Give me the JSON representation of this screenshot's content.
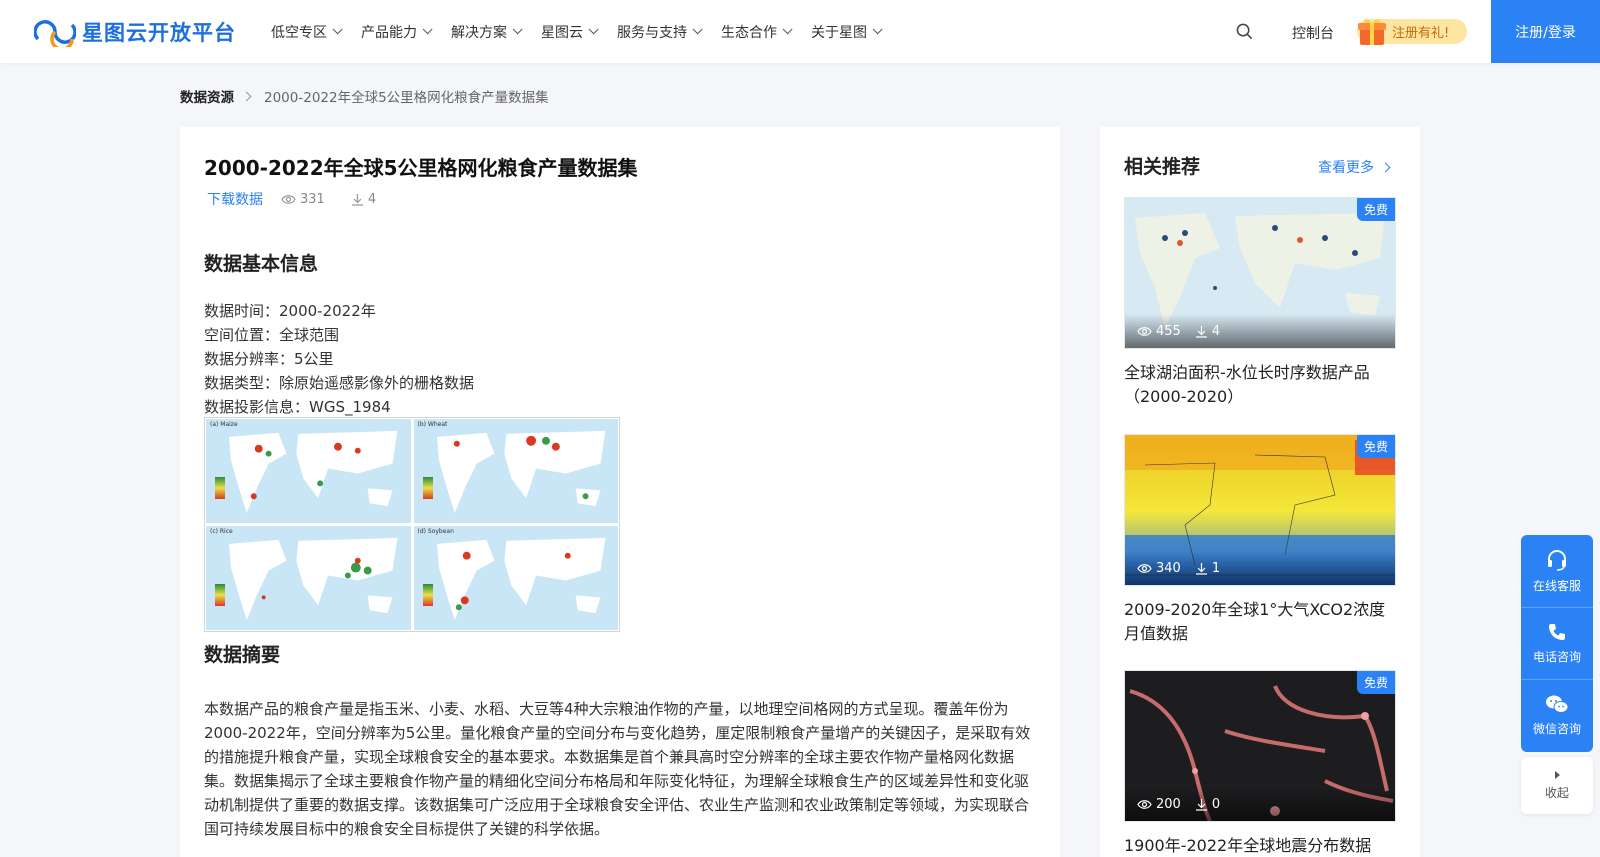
{
  "brand": {
    "name": "星图云开放平台",
    "accent": "#2a82f5"
  },
  "nav": {
    "items": [
      "低空专区",
      "产品能力",
      "解决方案",
      "星图云",
      "服务与支持",
      "生态合作",
      "关于星图"
    ],
    "console": "控制台",
    "gift": "注册有礼!",
    "login": "注册/登录"
  },
  "breadcrumb": {
    "root": "数据资源",
    "current": "2000-2022年全球5公里格网化粮食产量数据集"
  },
  "dataset": {
    "title": "2000-2022年全球5公里格网化粮食产量数据集",
    "download_label": "下载数据",
    "views": "331",
    "downloads": "4",
    "basic_heading": "数据基本信息",
    "info": [
      "数据时间：2000-2022年",
      "空间位置：全球范围",
      "数据分辨率：5公里",
      "数据类型：除原始遥感影像外的栅格数据",
      "数据投影信息：WGS_1984"
    ],
    "figure_panels": [
      "(a) Maize",
      "(b) Wheat",
      "(c) Rice",
      "(d) Soybean"
    ],
    "abstract_heading": "数据摘要",
    "abstract": "本数据产品的粮食产量是指玉米、小麦、水稻、大豆等4种大宗粮油作物的产量，以地理空间格网的方式呈现。覆盖年份为2000-2022年，空间分辨率为5公里。量化粮食产量的空间分布与变化趋势，厘定限制粮食产量增产的关键因子，是采取有效的措施提升粮食产量，实现全球粮食安全的基本要求。本数据集是首个兼具高时空分辨率的全球主要农作物产量格网化数据集。数据集揭示了全球主要粮食作物产量的精细化空间分布格局和年际变化特征，为理解全球粮食生产的区域差异性和变化驱动机制提供了重要的数据支撑。该数据集可广泛应用于全球粮食安全评估、农业生产监测和农业政策制定等领域，为实现联合国可持续发展目标中的粮食安全目标提供了关键的科学依据。"
  },
  "sidebar": {
    "heading": "相关推荐",
    "more": "查看更多",
    "cards": [
      {
        "badge": "免费",
        "views": "455",
        "downloads": "4",
        "title": "全球湖泊面积-水位长时序数据产品（2000-2020）"
      },
      {
        "badge": "免费",
        "views": "340",
        "downloads": "1",
        "title": "2009-2020年全球1°大气XCO2浓度月值数据"
      },
      {
        "badge": "免费",
        "views": "200",
        "downloads": "0",
        "title": "1900年-2022年全球地震分布数据"
      }
    ]
  },
  "float_service": {
    "online": "在线客服",
    "phone": "电话咨询",
    "wechat": "微信咨询",
    "collapse": "收起"
  }
}
